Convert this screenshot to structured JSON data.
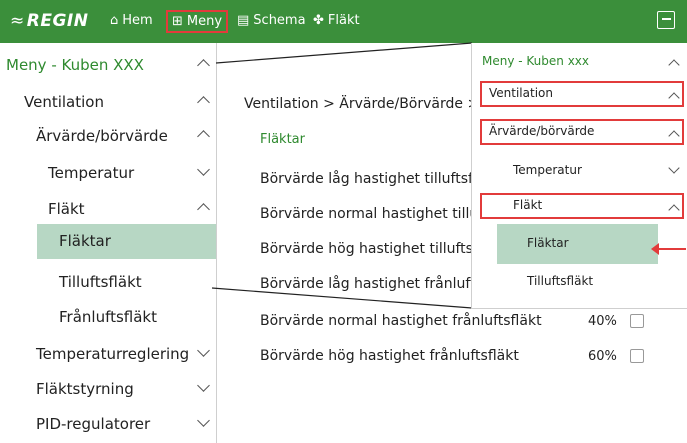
{
  "topbar": {
    "brand": "REGIN",
    "nav": [
      {
        "label": "Hem",
        "icon": "home-icon"
      },
      {
        "label": "Meny",
        "icon": "grid-menu-icon"
      },
      {
        "label": "Schema",
        "icon": "calendar-icon"
      },
      {
        "label": "Fläkt",
        "icon": "fan-icon"
      }
    ],
    "logout_icon": "logout-icon",
    "colors": {
      "bar": "#3b8f3b",
      "highlight": "#e23b3b"
    }
  },
  "sidebar": {
    "title": "Meny - Kuben XXX",
    "items": [
      {
        "label": "Ventilation",
        "chevron": "up"
      },
      {
        "label": "Ärvärde/börvärde",
        "chevron": "up"
      },
      {
        "label": "Temperatur",
        "chevron": "down"
      },
      {
        "label": "Fläkt",
        "chevron": "up"
      },
      {
        "label": "Fläktar",
        "selected": true
      },
      {
        "label": "Tilluftsfläkt"
      },
      {
        "label": "Frånluftsfläkt"
      },
      {
        "label": "Temperaturreglering",
        "chevron": "down"
      },
      {
        "label": "Fläktstyrning",
        "chevron": "down"
      },
      {
        "label": "PID-regulatorer",
        "chevron": "down"
      }
    ]
  },
  "main": {
    "breadcrumb": "Ventilation > Ärvärde/Börvärde >",
    "section": "Fläktar",
    "rows": [
      {
        "label": "Börvärde låg hastighet tilluftsfläkt",
        "value": ""
      },
      {
        "label": "Börvärde normal hastighet tilluftsfläkt",
        "value": ""
      },
      {
        "label": "Börvärde hög hastighet tilluftsfläkt",
        "value": ""
      },
      {
        "label": "Börvärde låg hastighet frånluftsfläkt",
        "value": ""
      },
      {
        "label": "Börvärde normal hastighet frånluftsfläkt",
        "value": "40%"
      },
      {
        "label": "Börvärde hög hastighet frånluftsfläkt",
        "value": "60%"
      }
    ]
  },
  "zoom": {
    "title": "Meny - Kuben xxx",
    "items": [
      {
        "label": "Ventilation",
        "chevron": "up",
        "boxed": true
      },
      {
        "label": "Ärvärde/börvärde",
        "chevron": "up",
        "boxed": true
      },
      {
        "label": "Temperatur",
        "chevron": "down"
      },
      {
        "label": "Fläkt",
        "chevron": "up",
        "boxed": true
      },
      {
        "label": "Fläktar",
        "selected": true
      },
      {
        "label": "Tilluftsfläkt"
      }
    ]
  }
}
